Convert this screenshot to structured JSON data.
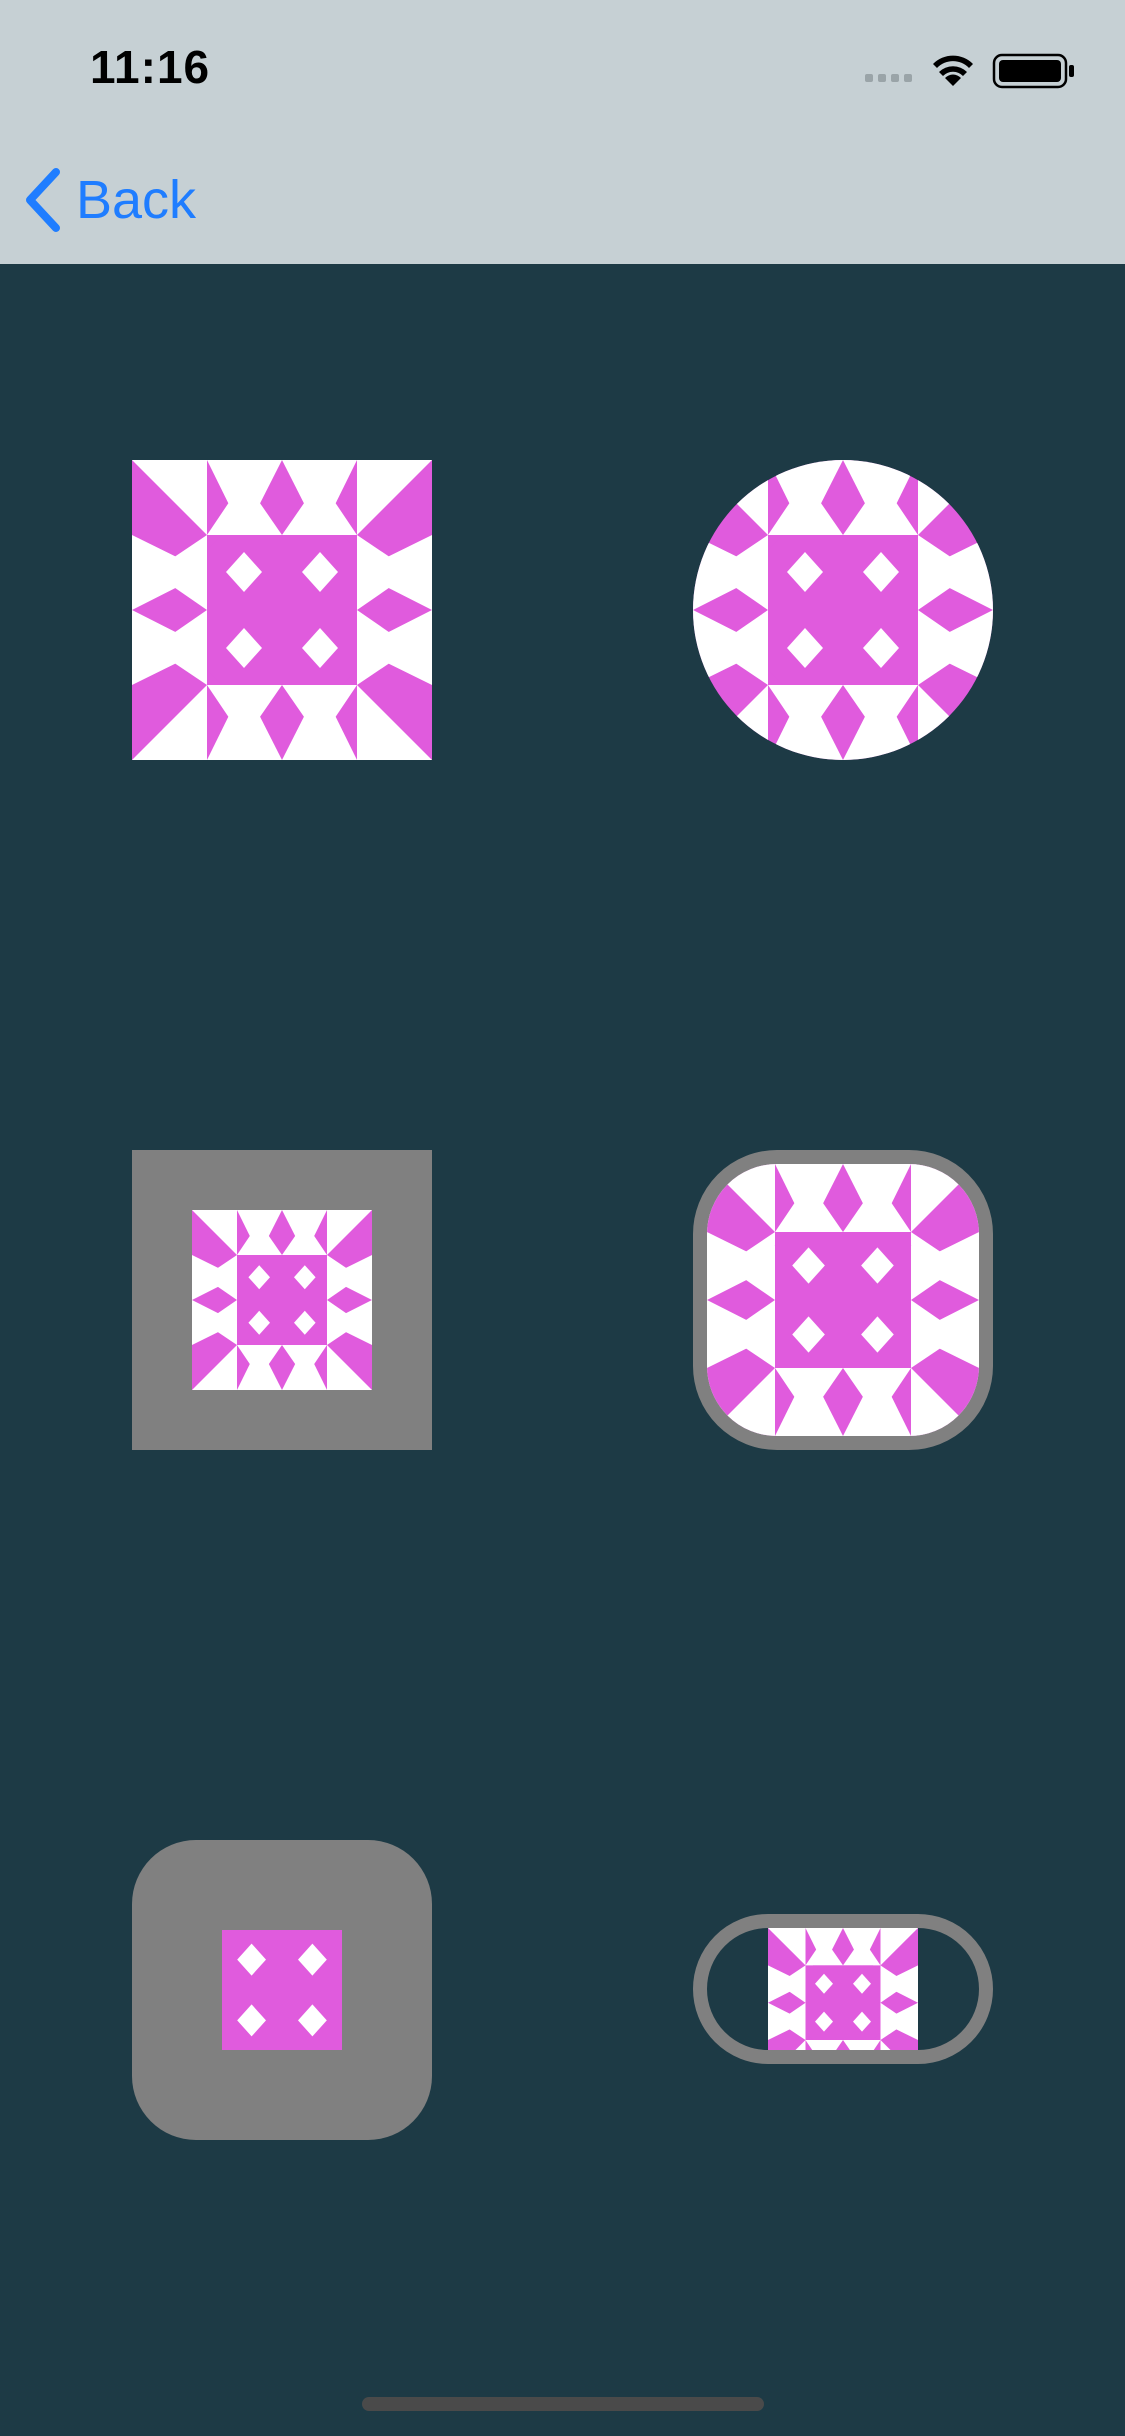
{
  "status_bar": {
    "time": "11:16",
    "icons": [
      "cellular-signal-icon",
      "wifi-icon",
      "battery-icon"
    ]
  },
  "nav_bar": {
    "back_label": "Back",
    "back_icon": "chevron-left-icon"
  },
  "colors": {
    "background": "#1d3a45",
    "bar_background": "#c6d0d4",
    "accent": "#1f7dff",
    "pattern_primary": "#e05bdd",
    "pattern_secondary": "#ffffff",
    "frame": "#808080"
  },
  "tiles": [
    {
      "name": "square-identicon",
      "shape": "square"
    },
    {
      "name": "circle-identicon",
      "shape": "circle"
    },
    {
      "name": "square-bordered-identicon",
      "shape": "square with gray border"
    },
    {
      "name": "rounded-bordered-identicon",
      "shape": "rounded square with gray border"
    },
    {
      "name": "rounded-padded-identicon",
      "shape": "rounded square with gray padding"
    },
    {
      "name": "capsule-bordered-identicon",
      "shape": "capsule with gray border"
    }
  ]
}
